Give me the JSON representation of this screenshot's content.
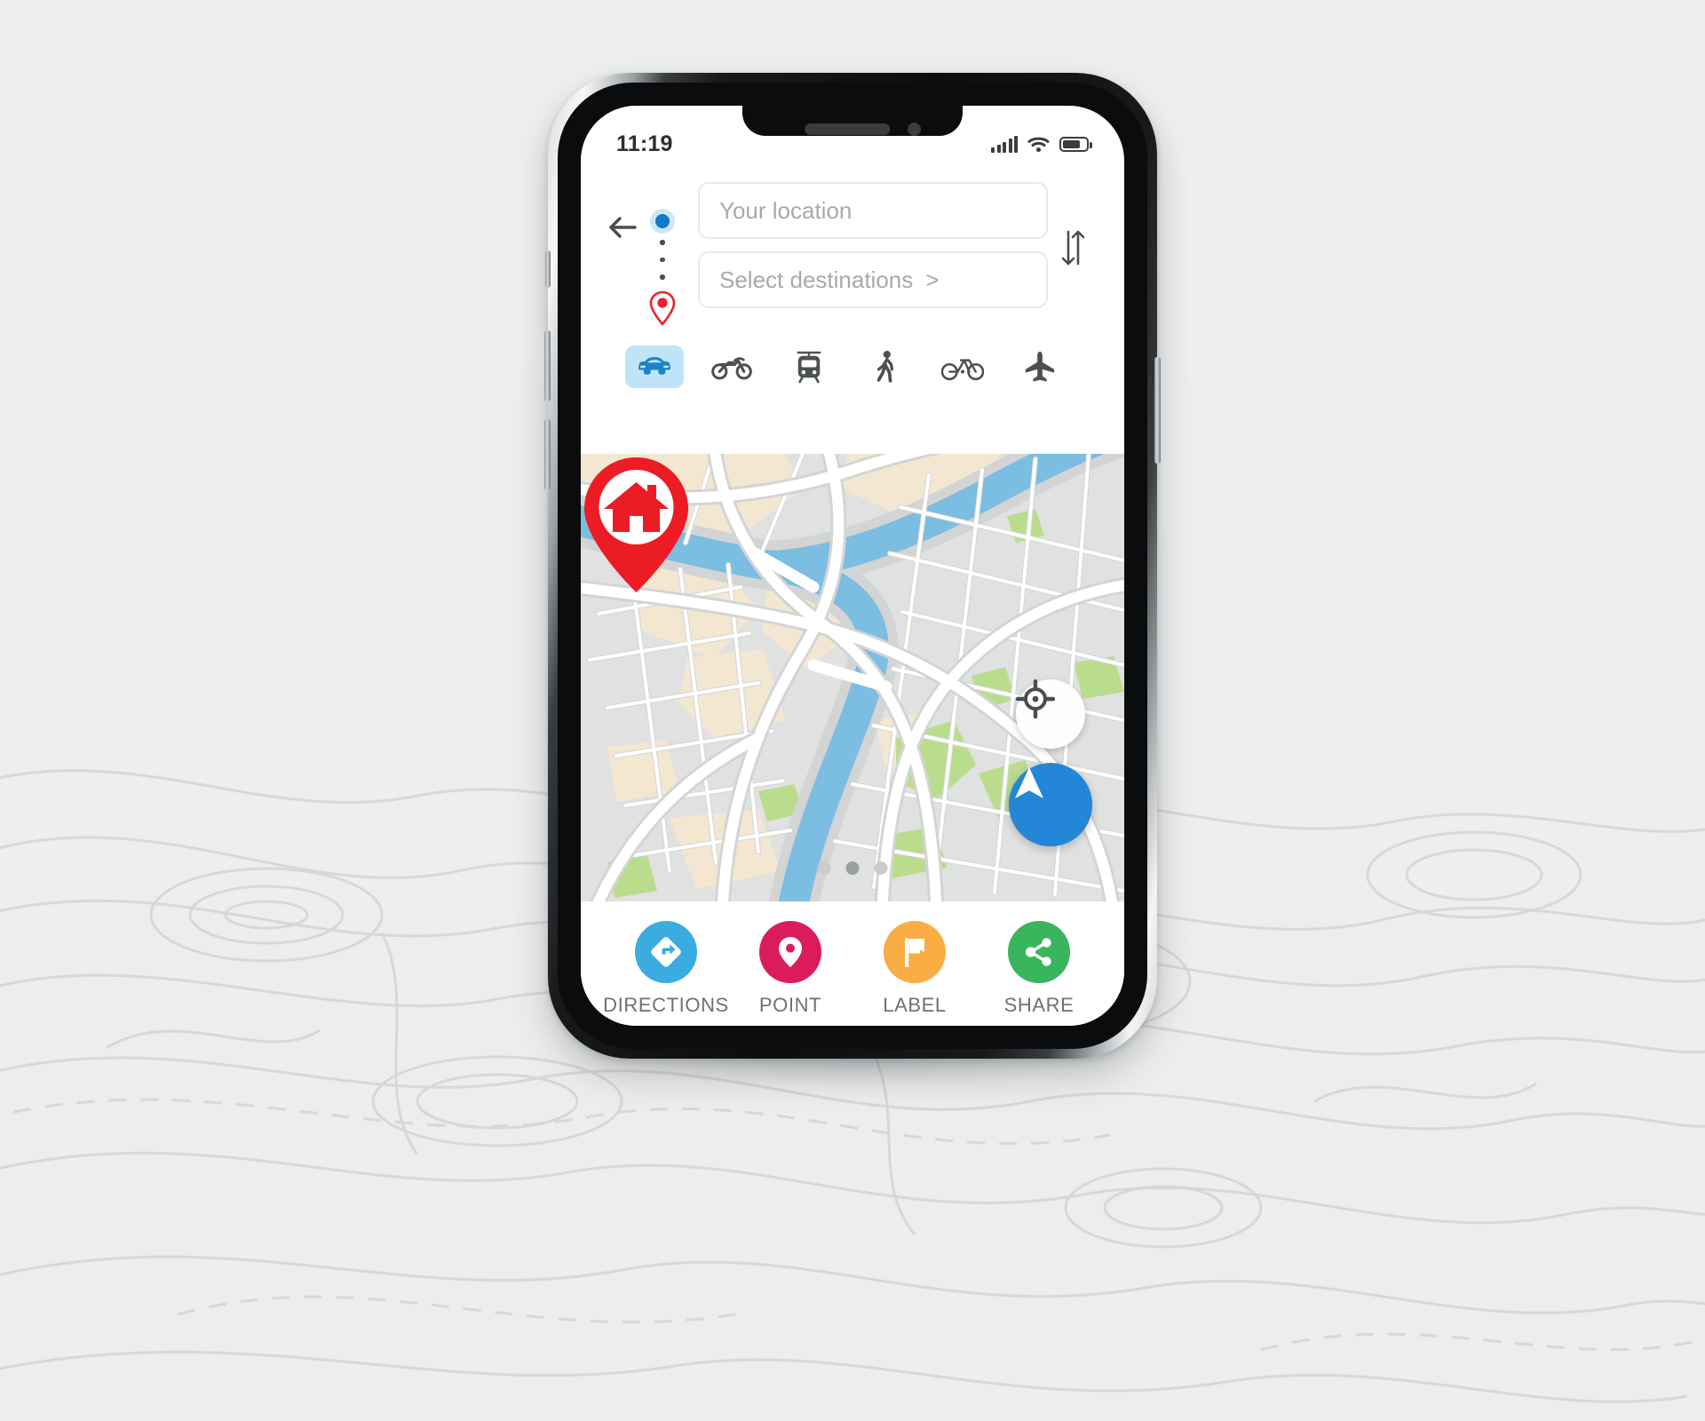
{
  "background": {
    "name": "topographic-contour-pattern",
    "base_color": "#f2f3f3",
    "line_color": "#dcdddd"
  },
  "device": {
    "name": "smartphone-mockup",
    "frame_color": "#0b0c0d",
    "screen_color": "#ffffff"
  },
  "statusbar": {
    "time": "11:19",
    "signal_icon": "cellular-signal-icon",
    "signal_bars_total": 5,
    "signal_bars_filled": 5,
    "wifi_icon": "wifi-icon",
    "battery_icon": "battery-icon",
    "battery_level_percent": 64
  },
  "search": {
    "back_icon": "back-arrow-icon",
    "origin_icon": "origin-dot-icon",
    "destination_icon": "destination-pin-icon",
    "swap_icon": "swap-vertical-icon",
    "origin_placeholder": "Your location",
    "origin_value": "",
    "destination_placeholder": "Select destinations",
    "destination_value": "",
    "destination_chevron": ">",
    "accent_blue": "#1279c6",
    "accent_red": "#e8242a"
  },
  "modes": {
    "active_index": 0,
    "active_bg": "#bfe4f8",
    "active_fg": "#1b84c6",
    "inactive_fg": "#4c5053",
    "items": [
      {
        "id": "car",
        "label": "Car",
        "icon": "car-icon"
      },
      {
        "id": "motorcycle",
        "label": "Motorcycle",
        "icon": "motorcycle-icon"
      },
      {
        "id": "transit",
        "label": "Transit",
        "icon": "tram-icon"
      },
      {
        "id": "walk",
        "label": "Walk",
        "icon": "walking-icon"
      },
      {
        "id": "bicycle",
        "label": "Bicycle",
        "icon": "bicycle-icon"
      },
      {
        "id": "flight",
        "label": "Flight",
        "icon": "airplane-icon"
      }
    ]
  },
  "map": {
    "land_color": "#e0e1e1",
    "water_color": "#7cbde2",
    "park_color": "#b9dd8c",
    "sand_color": "#f4e7d1",
    "road_color": "#ffffff",
    "road_casing_color": "#d3d4d4",
    "marker": {
      "icon": "home-pin-icon",
      "color": "#ec1c24",
      "label": "Home"
    },
    "locate_button": {
      "icon": "crosshair-icon",
      "bg": "#fdfdfd",
      "fg": "#4a4d50"
    },
    "navigate_button": {
      "icon": "navigation-arrow-icon",
      "bg": "#2486d6",
      "fg": "#ffffff"
    },
    "pagination": {
      "count": 3,
      "active_index": 1
    }
  },
  "actions": {
    "items": [
      {
        "label": "DIRECTIONS",
        "icon": "directions-icon",
        "color": "#3aace0"
      },
      {
        "label": "POINT",
        "icon": "map-pin-icon",
        "color": "#db1c5b"
      },
      {
        "label": "LABEL",
        "icon": "flag-icon",
        "color": "#f9ad44"
      },
      {
        "label": "SHARE",
        "icon": "share-icon",
        "color": "#3ab55e"
      }
    ]
  }
}
